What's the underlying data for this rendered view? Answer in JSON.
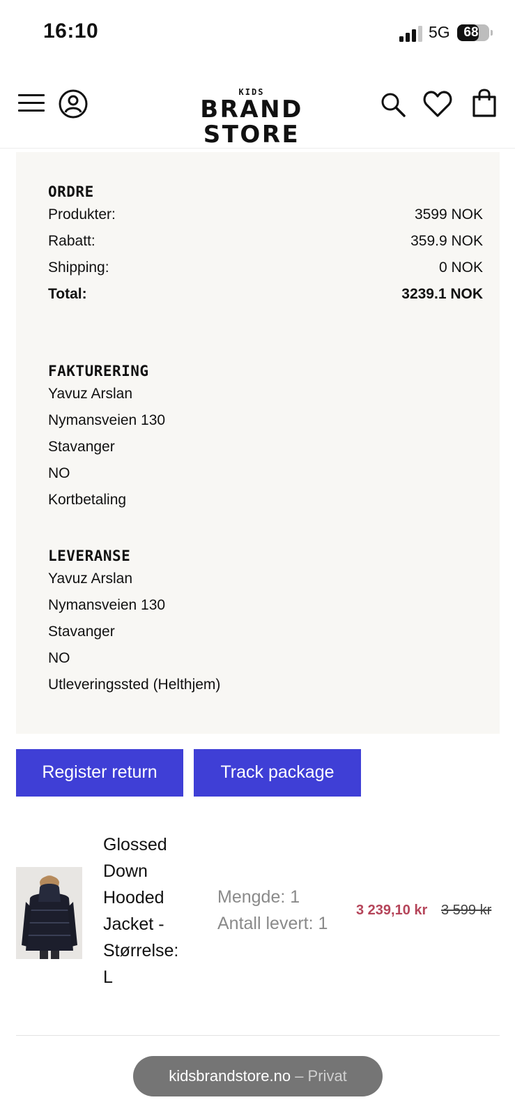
{
  "status_bar": {
    "time": "16:10",
    "network": "5G",
    "battery": "68",
    "battery_level": 0.68
  },
  "header": {
    "logo_small": "KIDS",
    "logo_main": "BRAND STORE",
    "icons": [
      "menu-icon",
      "account-icon",
      "search-icon",
      "heart-icon",
      "bag-icon"
    ]
  },
  "order": {
    "title": "ORDRE",
    "rows": [
      {
        "label": "Produkter:",
        "value": "3599 NOK"
      },
      {
        "label": "Rabatt:",
        "value": "359.9 NOK"
      },
      {
        "label": "Shipping:",
        "value": "0 NOK"
      },
      {
        "label": "Total:",
        "value": "3239.1 NOK"
      }
    ]
  },
  "billing": {
    "title": "FAKTURERING",
    "lines": [
      "Yavuz Arslan",
      "Nymansveien 130",
      "Stavanger",
      "NO",
      "Kortbetaling"
    ]
  },
  "delivery": {
    "title": "LEVERANSE",
    "lines": [
      "Yavuz Arslan",
      "Nymansveien 130",
      "Stavanger",
      "NO",
      "Utleveringssted (Helthjem)"
    ]
  },
  "actions": {
    "register_return": "Register return",
    "track_package": "Track package"
  },
  "product": {
    "name_lines": [
      "Glossed",
      "Down",
      "Hooded",
      "Jacket -",
      "Størrelse:",
      "L"
    ],
    "quantity": "Mengde: 1",
    "delivered": "Antall levert: 1",
    "price": "3 239,10 kr",
    "original_price": "3 599 kr"
  },
  "browser": {
    "domain": "kidsbrandstore.no",
    "mode": "– Privat"
  },
  "colors": {
    "accent": "#3f3fd6",
    "price_sale": "#b5455a",
    "card_bg": "#f8f7f4"
  }
}
